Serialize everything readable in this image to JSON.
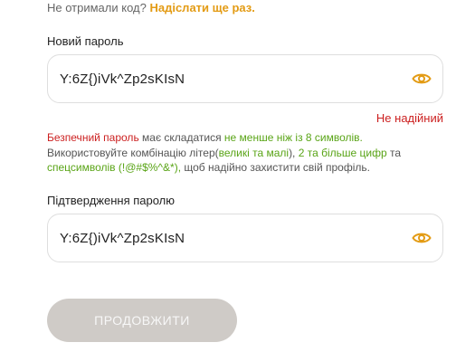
{
  "resend": {
    "question": "Не отримали код?",
    "link": "Надіслати ще раз."
  },
  "new_password": {
    "label": "Новий пароль",
    "value": "Y:6Z{)iVk^Zp2sKIsN",
    "eye_icon": "eye-icon",
    "strength": "Не надійний"
  },
  "hint": {
    "p1": "Безпечний пароль",
    "p2": " має складатися ",
    "p3": "не менше ніж із 8 символів.",
    "p4": " Використовуйте комбінацію літер(",
    "p5": "великі та малі",
    "p6": "), ",
    "p7": "2 та більше цифр",
    "p8": " та ",
    "p9": "спецсимволів (!@#$%^&*),",
    "p10": " щоб надійно захистити свій профіль."
  },
  "confirm_password": {
    "label": "Підтвердження паролю",
    "value": "Y:6Z{)iVk^Zp2sKIsN",
    "eye_icon": "eye-icon"
  },
  "continue_button": {
    "label": "ПРОДОВЖИТИ"
  },
  "colors": {
    "accent": "#e39b14",
    "error": "#cc2020",
    "success": "#59a416",
    "button_disabled": "#cfcbc7"
  }
}
